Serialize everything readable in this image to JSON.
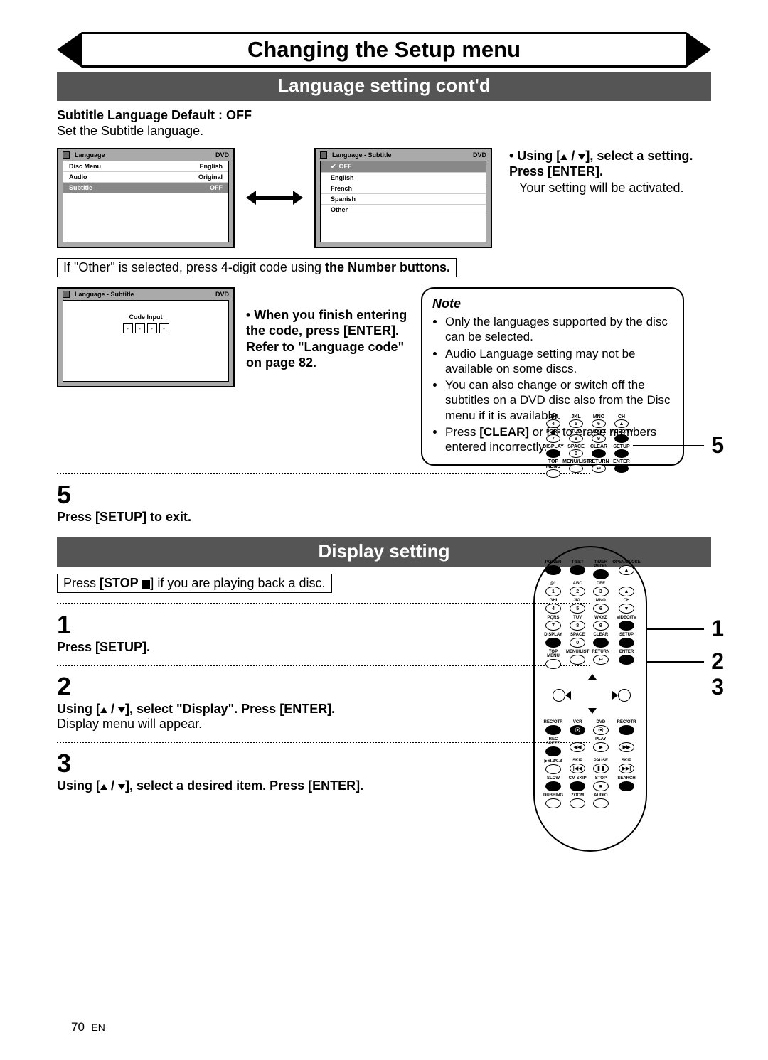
{
  "title": "Changing the Setup menu",
  "section1": "Language setting cont'd",
  "subtitle_lang": {
    "heading": "Subtitle Language Default : OFF",
    "desc": "Set the Subtitle language."
  },
  "osd_lang": {
    "title": "Language",
    "tag": "DVD",
    "rows": [
      {
        "k": "Disc Menu",
        "v": "English"
      },
      {
        "k": "Audio",
        "v": "Original"
      },
      {
        "k": "Subtitle",
        "v": "OFF"
      }
    ]
  },
  "osd_sub": {
    "title": "Language - Subtitle",
    "tag": "DVD",
    "opts": [
      "OFF",
      "English",
      "French",
      "Spanish",
      "Other"
    ]
  },
  "instruct1": {
    "p1a": "• Using [",
    "p1b": " / ",
    "p1c": "], select a setting. Press [ENTER].",
    "p2": "Your setting will be activated."
  },
  "boxed_other_a": "If \"Other\" is selected, press 4-digit code using ",
  "boxed_other_b": "the Number buttons.",
  "osd_code": {
    "title": "Language - Subtitle",
    "tag": "DVD",
    "label": "Code Input"
  },
  "code_instruct": "• When you finish entering the code, press [ENTER]. Refer to \"Language code\" on page 82.",
  "note": {
    "title": "Note",
    "items": [
      "Only the languages supported by the disc can be selected.",
      "Audio Language setting may not be available on some discs.",
      "You can also change or switch off the subtitles on a DVD disc also from the Disc menu if it is available."
    ],
    "last_a": "Press ",
    "last_b": "[CLEAR]",
    "last_c": " or [",
    "last_d": "] to erase numbers entered incorrectly."
  },
  "keypad_rows": [
    [
      "GHI",
      "JKL",
      "MNO",
      "CH"
    ],
    [
      "4",
      "5",
      "6",
      "▲"
    ],
    [
      "PQRS",
      "TUV",
      "WXYZ",
      "VIDEO/TV"
    ],
    [
      "7",
      "8",
      "9",
      ""
    ],
    [
      "DISPLAY",
      "SPACE",
      "CLEAR",
      "SETUP"
    ],
    [
      "",
      "0",
      "",
      ""
    ],
    [
      "TOP MENU",
      "MENU/LIST",
      "RETURN",
      "ENTER"
    ],
    [
      "",
      "",
      "",
      ""
    ]
  ],
  "step5_num": "5",
  "step5_txt": "Press [SETUP] to exit.",
  "callout5": "5",
  "section2": "Display setting",
  "boxed_stop_a": "Press ",
  "boxed_stop_b": "[STOP ",
  "boxed_stop_c": "] if you are playing back a disc.",
  "steps": [
    {
      "n": "1",
      "b": "Press [SETUP].",
      "s": ""
    },
    {
      "n": "2",
      "b_a": "Using [",
      "b_b": " / ",
      "b_c": "], select \"Display\". Press [ENTER].",
      "s": "Display menu will appear."
    },
    {
      "n": "3",
      "b_a": "Using [",
      "b_b": " / ",
      "b_c": "], select a desired item. Press [ENTER].",
      "s": ""
    }
  ],
  "remote_labels": {
    "r1": [
      "POWER",
      "",
      "",
      "OPEN/CLOSE"
    ],
    "r1b": [
      "",
      "T-SET",
      "TIMER PROG.",
      ""
    ],
    "r2": [
      "@!.",
      "ABC",
      "DEF",
      ""
    ],
    "r2n": [
      "1",
      "2",
      "3",
      "▲"
    ],
    "r3": [
      "GHI",
      "JKL",
      "MNO",
      "CH"
    ],
    "r3n": [
      "4",
      "5",
      "6",
      "▼"
    ],
    "r4": [
      "PQRS",
      "TUV",
      "WXYZ",
      "VIDEO/TV"
    ],
    "r4n": [
      "7",
      "8",
      "9",
      ""
    ],
    "r5": [
      "DISPLAY",
      "SPACE",
      "CLEAR",
      "SETUP"
    ],
    "r5n": [
      "",
      "0",
      "",
      ""
    ],
    "r6": [
      "TOP MENU",
      "MENU/LIST",
      "RETURN",
      "ENTER"
    ],
    "r7": [
      "REC/OTR",
      "VCR",
      "DVD",
      "REC/OTR"
    ],
    "r8": [
      "REC SPEED",
      "",
      "PLAY",
      ""
    ],
    "r9": [
      "▶xI.3/0.8",
      "SKIP",
      "PAUSE",
      "SKIP"
    ],
    "r10": [
      "SLOW",
      "CM SKIP",
      "STOP",
      "SEARCH"
    ],
    "r11": [
      "DUBBING",
      "ZOOM",
      "AUDIO",
      ""
    ]
  },
  "callouts": {
    "c1": "1",
    "c2": "2",
    "c3": "3"
  },
  "page": "70",
  "page_lang": "EN"
}
